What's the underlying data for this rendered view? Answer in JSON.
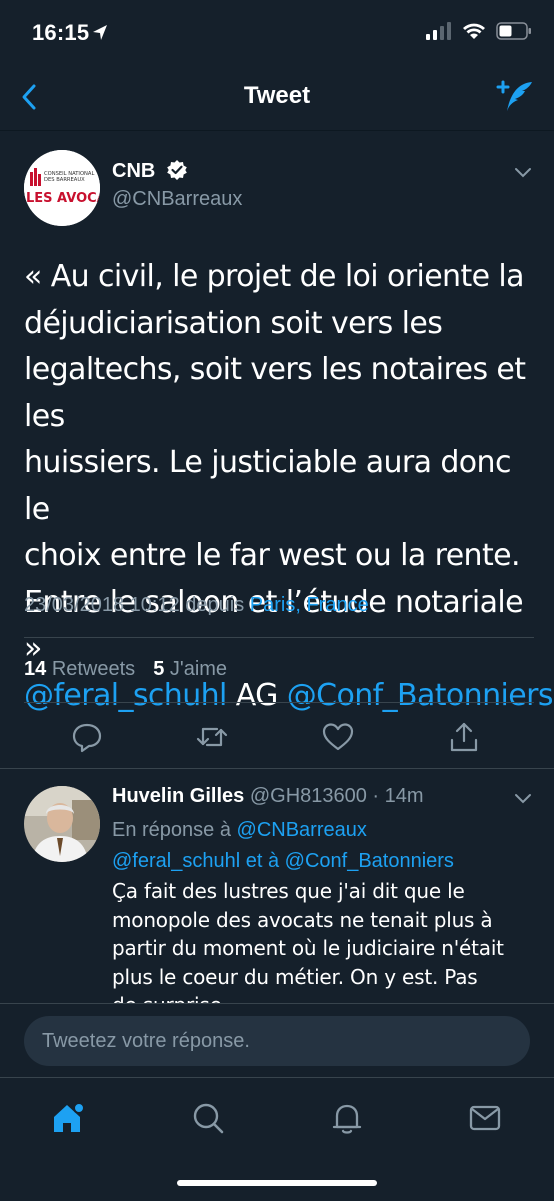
{
  "status_bar": {
    "time": "16:15"
  },
  "nav": {
    "title": "Tweet"
  },
  "tweet": {
    "author_name": "CNB",
    "handle": "@CNBarreaux",
    "avatar_text_top": "CONSEIL NATIONAL DES BARREAUX",
    "avatar_text_main": "LES AVOCATS",
    "text_lines": [
      "« Au civil, le projet de loi oriente la",
      "déjudiciarisation soit vers les",
      "legaltechs, soit vers les notaires et les",
      "huissiers. Le justiciable aura donc le",
      "choix entre le far west ou la rente.",
      "Entre le saloon et l’étude notariale »"
    ],
    "mention_1": "@feral_schuhl",
    "mid_text": " AG ",
    "mention_2": "@Conf_Batonniers",
    "date": "23/03/2018 10:12 depuis ",
    "location": "Paris, France",
    "retweets_count": "14",
    "retweets_label": "Retweets",
    "likes_count": "5",
    "likes_label": "J'aime"
  },
  "reply": {
    "name": "Huvelin Gilles",
    "handle": "@GH813600",
    "time": " · 14m",
    "in_reply_prefix": "En réponse à ",
    "in_reply_user1": "@CNBarreaux",
    "in_reply_user2": "@feral_schuhl",
    "in_reply_and": " et à ",
    "in_reply_user3": "@Conf_Batonniers",
    "text_lines": [
      "Ça fait des lustres que j'ai dit que le",
      "monopole des avocats ne tenait plus à",
      "partir du moment où le judiciaire n'était",
      "plus le coeur du métier. On y est. Pas",
      "de surprise."
    ]
  },
  "composer": {
    "placeholder": "Tweetez votre réponse."
  },
  "colors": {
    "background": "#15202b",
    "accent": "#1da1f2",
    "secondary_text": "#8899a6"
  }
}
